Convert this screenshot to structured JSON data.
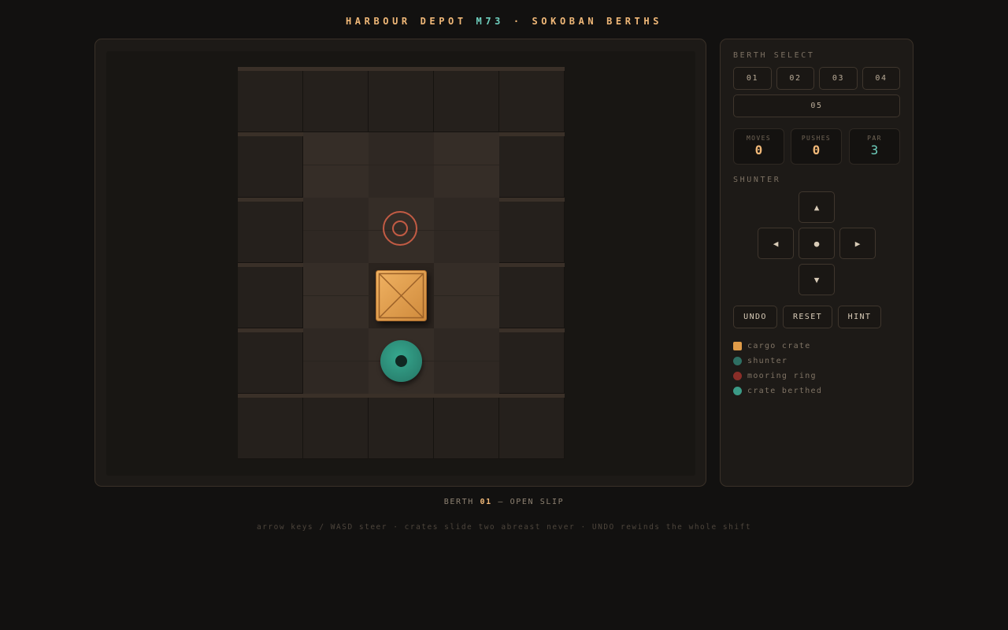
{
  "header": {
    "title_part1": "HARBOUR DEPOT ",
    "title_code": "M73",
    "title_part2": " · SOKOBAN BERTHS"
  },
  "board": {
    "cols": 5,
    "rows": 6,
    "tiles": [
      "#####",
      "#   #",
      "# . #",
      "# $ #",
      "# @ #",
      "#####"
    ],
    "legend_codes": {
      "wall": "#",
      "floor": " ",
      "target": ".",
      "crate": "$",
      "player": "@"
    }
  },
  "sidebar": {
    "berth_select_label": "BERTH SELECT",
    "berths": [
      "01",
      "02",
      "03",
      "04",
      "05"
    ],
    "stats": [
      {
        "label": "MOVES",
        "value": "0"
      },
      {
        "label": "PUSHES",
        "value": "0"
      },
      {
        "label": "PAR",
        "value": "3"
      }
    ],
    "shunter_label": "SHUNTER",
    "dpad": {
      "up": "▲",
      "left": "◀",
      "center": "●",
      "right": "▶",
      "down": "▼"
    },
    "actions": [
      "UNDO",
      "RESET",
      "HINT"
    ],
    "legend": [
      {
        "label": "cargo crate",
        "color": "#e09b48",
        "shape": "square"
      },
      {
        "label": "shunter",
        "color": "#2e6f63",
        "shape": "circle"
      },
      {
        "label": "mooring ring",
        "color": "#8a2e28",
        "shape": "circle"
      },
      {
        "label": "crate berthed",
        "color": "#3b9a86",
        "shape": "circle"
      }
    ]
  },
  "status": {
    "prefix": "BERTH ",
    "number": "01",
    "suffix": " — OPEN SLIP"
  },
  "hint_line": "arrow keys / WASD steer · crates slide two abreast never · UNDO rewinds the whole shift",
  "colors": {
    "accent": "#f0b878",
    "teal": "#6fd0bf",
    "wall": "#25201c",
    "floor": "#352d27",
    "target": "#c25b44",
    "crate": "#e09b48",
    "player": "#2a8471"
  }
}
